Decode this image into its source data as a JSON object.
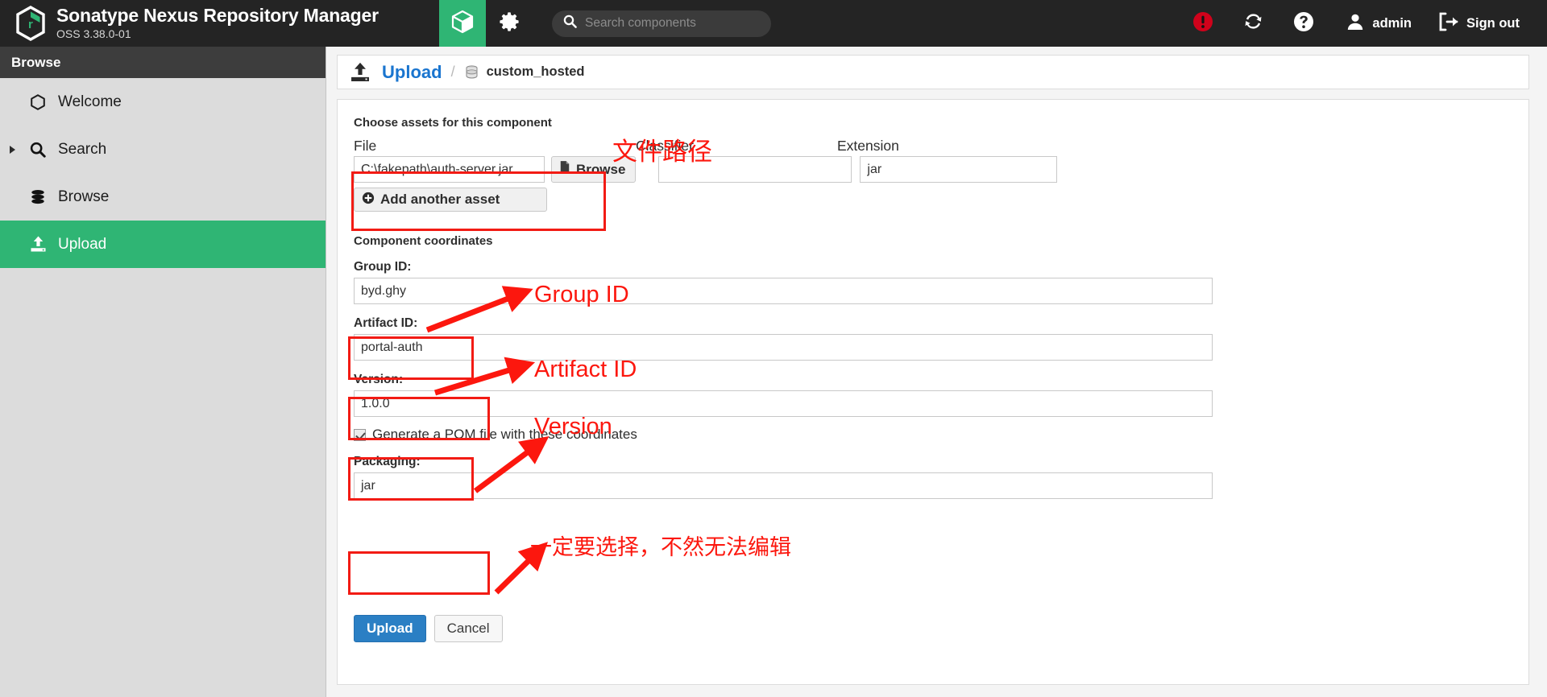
{
  "header": {
    "brand_title": "Sonatype Nexus Repository Manager",
    "brand_subtitle": "OSS 3.38.0-01",
    "box_icon": "cube-icon",
    "gear_icon": "gear-icon",
    "search_placeholder": "Search components",
    "search_value": "",
    "search_icon": "search-icon",
    "alert_icon": "alert-circle-icon",
    "refresh_icon": "refresh-icon",
    "help_icon": "help-circle-icon",
    "user_icon": "user-icon",
    "user_name": "admin",
    "signout_icon": "signout-icon",
    "signout_label": "Sign out"
  },
  "sidebar": {
    "title": "Browse",
    "items": [
      {
        "label": "Welcome",
        "icon": "hexagon-icon",
        "active": false,
        "expandable": false
      },
      {
        "label": "Search",
        "icon": "search-icon",
        "active": false,
        "expandable": true
      },
      {
        "label": "Browse",
        "icon": "database-icon",
        "active": false,
        "expandable": false
      },
      {
        "label": "Upload",
        "icon": "upload-icon",
        "active": true,
        "expandable": false
      }
    ]
  },
  "breadcrumb": {
    "icon": "upload-icon",
    "title": "Upload",
    "separator": "/",
    "repo_icon": "database-icon",
    "repo_name": "custom_hosted"
  },
  "form": {
    "assets_section_label": "Choose assets for this component",
    "file_col_label": "File",
    "classifier_col_label": "Classifier",
    "extension_col_label": "Extension",
    "file_value": "C:\\fakepath\\auth-server.jar",
    "browse_label": "Browse",
    "browse_icon": "file-icon",
    "classifier_value": "",
    "classifier_placeholder": "",
    "extension_value": "jar",
    "add_asset_label": "Add another asset",
    "add_asset_icon": "plus-circle-icon",
    "coordinates_section_label": "Component coordinates",
    "group_id_label": "Group ID:",
    "group_id_value": "byd.ghy",
    "artifact_id_label": "Artifact ID:",
    "artifact_id_value": "portal-auth",
    "version_label": "Version:",
    "version_value": "1.0.0",
    "generate_pom_label": "Generate a POM file with these coordinates",
    "generate_pom_checked": true,
    "packaging_label": "Packaging:",
    "packaging_value": "jar",
    "upload_button_label": "Upload",
    "cancel_button_label": "Cancel"
  },
  "annotations": {
    "file_path": "文件路径",
    "group_id": "Group ID",
    "artifact_id": "Artifact ID",
    "version": "Version",
    "packaging_note": "一定要选择，不然无法编辑"
  },
  "colors": {
    "accent_green": "#2fb574",
    "header_dark": "#242424",
    "sidebar_bg": "#dcdcdc",
    "link_blue": "#1a75cf",
    "button_blue": "#2b7fc4",
    "annotation_red": "#fc170e",
    "alert_red": "#d0021b"
  }
}
